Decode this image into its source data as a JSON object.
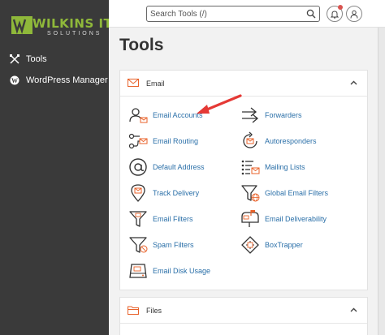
{
  "brand": {
    "name": "WILKINS IT",
    "sub": "SOLUTIONS"
  },
  "sidebar": {
    "items": [
      {
        "label": "Tools",
        "icon": "tools-icon"
      },
      {
        "label": "WordPress Manager",
        "icon": "wordpress-icon"
      }
    ]
  },
  "header": {
    "search_placeholder": "Search Tools (/)"
  },
  "page": {
    "title": "Tools"
  },
  "email": {
    "title": "Email",
    "tools": [
      {
        "label": "Email Accounts",
        "icon": "email-accounts-icon"
      },
      {
        "label": "Forwarders",
        "icon": "forwarders-icon"
      },
      {
        "label": "Email Routing",
        "icon": "email-routing-icon"
      },
      {
        "label": "Autoresponders",
        "icon": "autoresponders-icon"
      },
      {
        "label": "Default Address",
        "icon": "at-sign-icon"
      },
      {
        "label": "Mailing Lists",
        "icon": "mailing-lists-icon"
      },
      {
        "label": "Track Delivery",
        "icon": "track-delivery-icon"
      },
      {
        "label": "Global Email Filters",
        "icon": "global-filter-icon"
      },
      {
        "label": "Email Filters",
        "icon": "filter-icon"
      },
      {
        "label": "Email Deliverability",
        "icon": "mailbox-icon"
      },
      {
        "label": "Spam Filters",
        "icon": "spam-filter-icon"
      },
      {
        "label": "BoxTrapper",
        "icon": "boxtrapper-icon"
      },
      {
        "label": "Email Disk Usage",
        "icon": "disk-usage-icon"
      }
    ]
  },
  "files": {
    "title": "Files"
  },
  "colors": {
    "sidebar": "#3a3a3a",
    "accent": "#e8622a",
    "link": "#2a6fa8",
    "annotation": "#e53935"
  }
}
